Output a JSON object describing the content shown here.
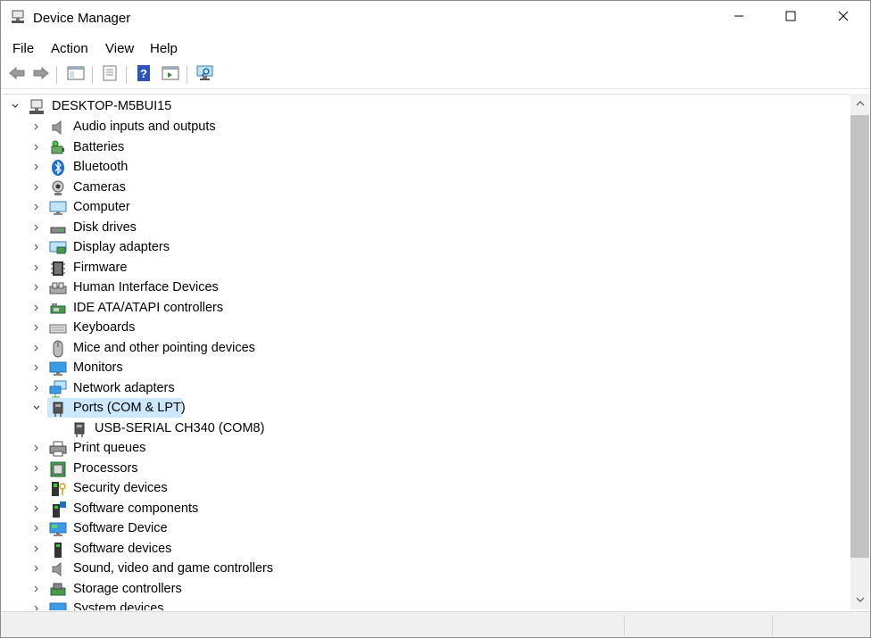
{
  "window": {
    "title": "Device Manager",
    "app_icon": "device-manager-icon",
    "controls": [
      "minimize-icon",
      "maximize-icon",
      "close-icon"
    ]
  },
  "menu": {
    "items": [
      "File",
      "Action",
      "View",
      "Help"
    ]
  },
  "toolbar": {
    "buttons": [
      "back-arrow-icon",
      "forward-arrow-icon",
      "show-hide-console-tree-icon",
      "properties-icon",
      "help-icon",
      "show-action-pane-icon",
      "scan-hardware-changes-icon"
    ]
  },
  "tree": {
    "root": "DESKTOP-M5BUI15",
    "categories": [
      {
        "label": "Audio inputs and outputs",
        "icon": "speaker-icon"
      },
      {
        "label": "Batteries",
        "icon": "battery-icon"
      },
      {
        "label": "Bluetooth",
        "icon": "bluetooth-icon"
      },
      {
        "label": "Cameras",
        "icon": "camera-icon"
      },
      {
        "label": "Computer",
        "icon": "computer-icon"
      },
      {
        "label": "Disk drives",
        "icon": "disk-drive-icon"
      },
      {
        "label": "Display adapters",
        "icon": "display-adapter-icon"
      },
      {
        "label": "Firmware",
        "icon": "firmware-icon"
      },
      {
        "label": "Human Interface Devices",
        "icon": "hid-icon"
      },
      {
        "label": "IDE ATA/ATAPI controllers",
        "icon": "ide-controller-icon"
      },
      {
        "label": "Keyboards",
        "icon": "keyboard-icon"
      },
      {
        "label": "Mice and other pointing devices",
        "icon": "mouse-icon"
      },
      {
        "label": "Monitors",
        "icon": "monitor-icon"
      },
      {
        "label": "Network adapters",
        "icon": "network-adapter-icon"
      },
      {
        "label": "Ports (COM & LPT)",
        "icon": "port-icon",
        "expanded": true,
        "selected": true,
        "children": [
          {
            "label": "USB-SERIAL CH340 (COM8)",
            "icon": "port-icon"
          }
        ]
      },
      {
        "label": "Print queues",
        "icon": "printer-icon"
      },
      {
        "label": "Processors",
        "icon": "processor-icon"
      },
      {
        "label": "Security devices",
        "icon": "security-device-icon"
      },
      {
        "label": "Software components",
        "icon": "software-component-icon"
      },
      {
        "label": "Software Device",
        "icon": "software-device-icon"
      },
      {
        "label": "Software devices",
        "icon": "software-devices-icon"
      },
      {
        "label": "Sound, video and game controllers",
        "icon": "sound-controller-icon"
      },
      {
        "label": "Storage controllers",
        "icon": "storage-controller-icon"
      },
      {
        "label": "System devices",
        "icon": "system-device-icon"
      }
    ]
  },
  "colors": {
    "selection": "#cce8ff",
    "scrollbar_thumb": "#c2c2c2"
  }
}
